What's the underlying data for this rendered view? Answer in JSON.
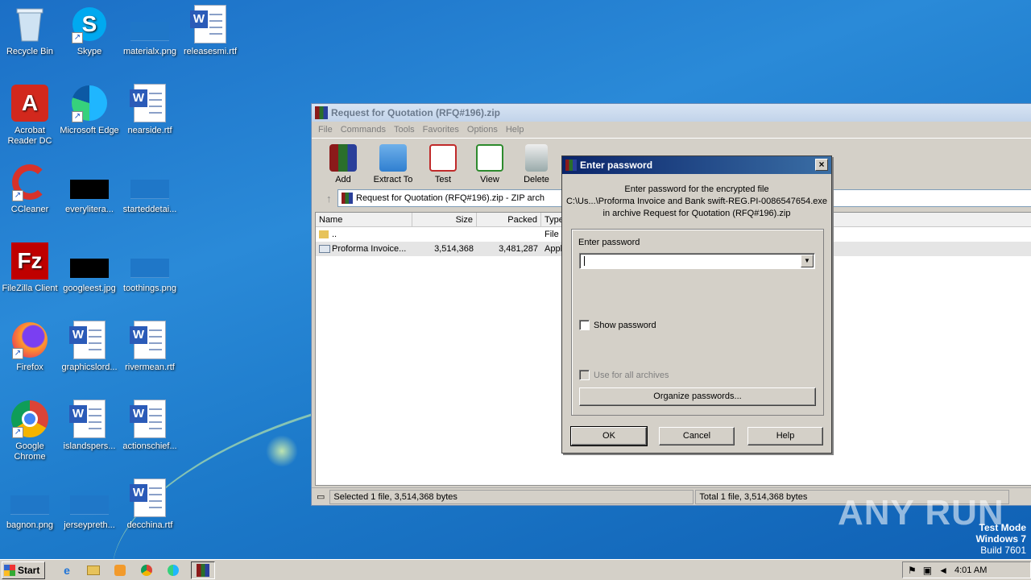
{
  "desktop": {
    "icons": [
      {
        "label": "Recycle Bin",
        "icon": "recycle-bin-icon"
      },
      {
        "label": "Skype",
        "icon": "skype-icon"
      },
      {
        "label": "materialx.png",
        "icon": "image-file-icon"
      },
      {
        "label": "releasesmi.rtf",
        "icon": "word-document-icon"
      },
      {
        "label": "Acrobat Reader DC",
        "icon": "acrobat-icon"
      },
      {
        "label": "Microsoft Edge",
        "icon": "edge-icon"
      },
      {
        "label": "nearside.rtf",
        "icon": "word-document-icon"
      },
      {
        "label": "CCleaner",
        "icon": "ccleaner-icon"
      },
      {
        "label": "everylitera...",
        "icon": "image-file-icon"
      },
      {
        "label": "starteddetai...",
        "icon": "image-file-icon"
      },
      {
        "label": "FileZilla Client",
        "icon": "filezilla-icon"
      },
      {
        "label": "googleest.jpg",
        "icon": "image-file-icon"
      },
      {
        "label": "toothings.png",
        "icon": "image-file-icon"
      },
      {
        "label": "Firefox",
        "icon": "firefox-icon"
      },
      {
        "label": "graphicslord...",
        "icon": "word-document-icon"
      },
      {
        "label": "rivermean.rtf",
        "icon": "word-document-icon"
      },
      {
        "label": "Google Chrome",
        "icon": "chrome-icon"
      },
      {
        "label": "islandspers...",
        "icon": "word-document-icon"
      },
      {
        "label": "actionschief...",
        "icon": "word-document-icon"
      },
      {
        "label": "bagnon.png",
        "icon": "image-file-icon"
      },
      {
        "label": "jerseypreth...",
        "icon": "image-file-icon"
      },
      {
        "label": "decchina.rtf",
        "icon": "word-document-icon"
      }
    ]
  },
  "winrar": {
    "title": "Request for Quotation (RFQ#196).zip",
    "menu": [
      "File",
      "Commands",
      "Tools",
      "Favorites",
      "Options",
      "Help"
    ],
    "toolbar": [
      "Add",
      "Extract To",
      "Test",
      "View",
      "Delete"
    ],
    "address": "Request for Quotation (RFQ#196).zip - ZIP arch",
    "columns": [
      "Name",
      "Size",
      "Packed",
      "Type"
    ],
    "rows": [
      {
        "name": "..",
        "size": "",
        "packed": "",
        "type": "File"
      },
      {
        "name": "Proforma Invoice...",
        "size": "3,514,368",
        "packed": "3,481,287",
        "type": "Appl"
      }
    ],
    "status_left": "Selected 1 file, 3,514,368 bytes",
    "status_right": "Total 1 file, 3,514,368 bytes"
  },
  "dialog": {
    "title": "Enter password",
    "close": "×",
    "message_line1": "Enter password for the encrypted file",
    "message_line2": "C:\\Us...\\Proforma Invoice and Bank swift-REG.PI-0086547654.exe",
    "message_line3": "in archive Request for Quotation (RFQ#196).zip",
    "group_label": "Enter password",
    "password_value": "",
    "show_password": "Show password",
    "use_all": "Use for all archives",
    "organize": "Organize passwords...",
    "ok": "OK",
    "cancel": "Cancel",
    "help": "Help"
  },
  "taskbar": {
    "start": "Start",
    "clock": "4:01 AM"
  },
  "overlay": {
    "watermark": "ANY RUN",
    "testmode1": "Test Mode",
    "testmode2": "Windows 7",
    "testmode3": "Build 7601"
  }
}
